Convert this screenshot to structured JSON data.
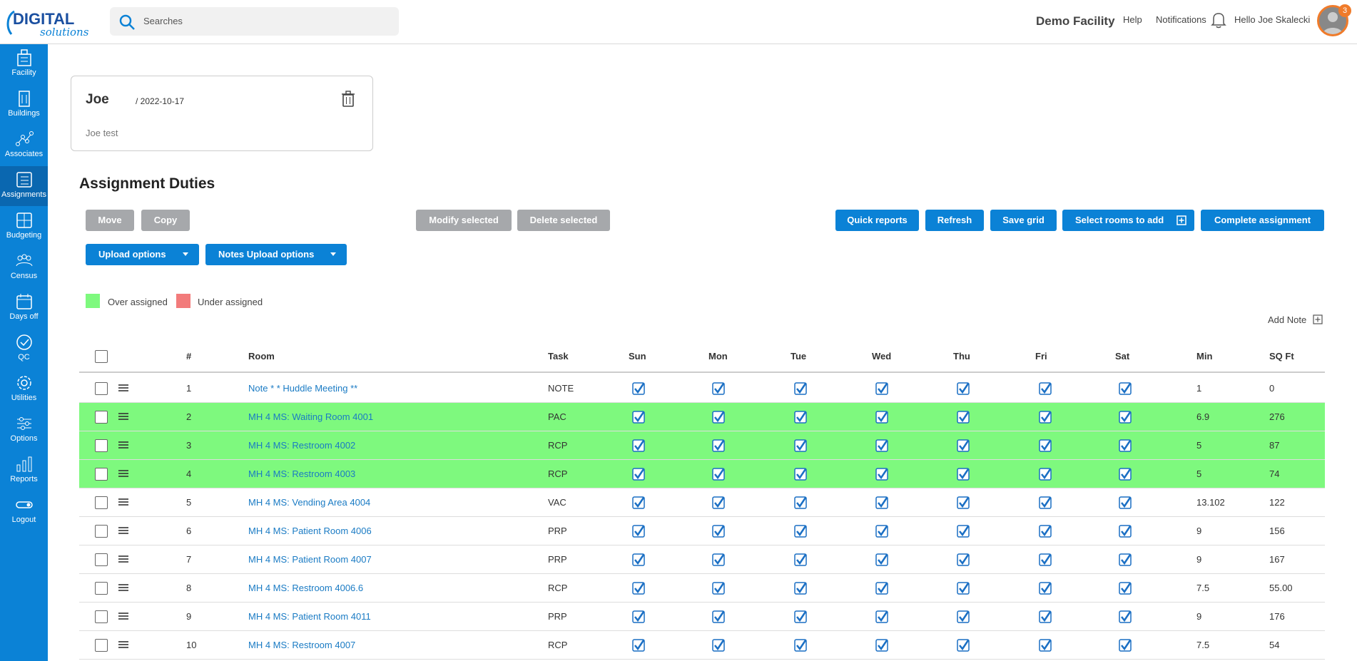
{
  "header": {
    "logo_text": "DIGITAL solutions",
    "search_placeholder": "Searches",
    "facility": "Demo Facility",
    "help": "Help",
    "notifications": "Notifications",
    "notification_count": "3",
    "greeting": "Hello Joe Skalecki"
  },
  "sidebar": {
    "items": [
      {
        "label": "Facility",
        "icon": "facility-icon"
      },
      {
        "label": "Buildings",
        "icon": "buildings-icon"
      },
      {
        "label": "Associates",
        "icon": "associates-icon"
      },
      {
        "label": "Assignments",
        "icon": "assignments-icon"
      },
      {
        "label": "Budgeting",
        "icon": "budgeting-icon"
      },
      {
        "label": "Census",
        "icon": "census-icon"
      },
      {
        "label": "Days off",
        "icon": "calendar-icon"
      },
      {
        "label": "QC",
        "icon": "qc-icon"
      },
      {
        "label": "Utilities",
        "icon": "utilities-icon"
      },
      {
        "label": "Options",
        "icon": "options-icon"
      },
      {
        "label": "Reports",
        "icon": "reports-icon"
      },
      {
        "label": "Logout",
        "icon": "logout-icon"
      }
    ]
  },
  "note_card": {
    "name": "Joe",
    "date": "/ 2022-10-17",
    "body": "Joe test"
  },
  "page_title": "Assignment Duties",
  "toolbar": {
    "move": "Move",
    "copy": "Copy",
    "modify_selected": "Modify selected",
    "delete_selected": "Delete selected",
    "quick_reports": "Quick reports",
    "refresh": "Refresh",
    "save_grid": "Save grid",
    "select_rooms": "Select rooms to add",
    "complete_assignment": "Complete assignment",
    "upload_options": "Upload options",
    "notes_upload_options": "Notes Upload options"
  },
  "legend": {
    "over": "Over assigned",
    "under": "Under assigned",
    "over_color": "#7ef97e",
    "under_color": "#f27b7b"
  },
  "add_note": "Add Note",
  "table": {
    "headers": [
      "#",
      "Room",
      "Task",
      "Sun",
      "Mon",
      "Tue",
      "Wed",
      "Thu",
      "Fri",
      "Sat",
      "Min",
      "SQ Ft"
    ],
    "rows": [
      {
        "num": "1",
        "room": "Note * * Huddle Meeting **",
        "task": "NOTE",
        "min": "1",
        "sqft": "0",
        "status": "normal"
      },
      {
        "num": "2",
        "room": "MH 4 MS: Waiting Room 4001",
        "task": "PAC",
        "min": "6.9",
        "sqft": "276",
        "status": "over"
      },
      {
        "num": "3",
        "room": "MH 4 MS: Restroom 4002",
        "task": "RCP",
        "min": "5",
        "sqft": "87",
        "status": "over"
      },
      {
        "num": "4",
        "room": "MH 4 MS: Restroom 4003",
        "task": "RCP",
        "min": "5",
        "sqft": "74",
        "status": "over"
      },
      {
        "num": "5",
        "room": "MH 4 MS: Vending Area 4004",
        "task": "VAC",
        "min": "13.102",
        "sqft": "122",
        "status": "normal"
      },
      {
        "num": "6",
        "room": "MH 4 MS: Patient Room 4006",
        "task": "PRP",
        "min": "9",
        "sqft": "156",
        "status": "normal"
      },
      {
        "num": "7",
        "room": "MH 4 MS: Patient Room 4007",
        "task": "PRP",
        "min": "9",
        "sqft": "167",
        "status": "normal"
      },
      {
        "num": "8",
        "room": "MH 4 MS: Restroom 4006.6",
        "task": "RCP",
        "min": "7.5",
        "sqft": "55.00",
        "status": "normal"
      },
      {
        "num": "9",
        "room": "MH 4 MS: Patient Room 4011",
        "task": "PRP",
        "min": "9",
        "sqft": "176",
        "status": "normal"
      },
      {
        "num": "10",
        "room": "MH 4 MS: Restroom 4007",
        "task": "RCP",
        "min": "7.5",
        "sqft": "54",
        "status": "normal"
      }
    ]
  }
}
